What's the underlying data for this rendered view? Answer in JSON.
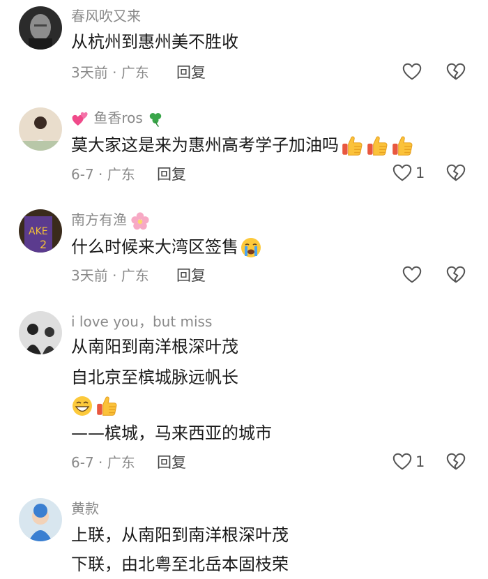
{
  "comments": [
    {
      "username": "春风吹又来",
      "lines": [
        "从杭州到惠州美不胜收"
      ],
      "meta": "3天前 · 广东",
      "reply": "回复",
      "like_count": ""
    },
    {
      "username": "鱼香ros",
      "lines": [
        "莫大家这是来为惠州高考学子加油吗"
      ],
      "meta": "6-7 · 广东",
      "reply": "回复",
      "like_count": "1"
    },
    {
      "username": "南方有渔",
      "lines": [
        "什么时候来大湾区签售"
      ],
      "meta": "3天前 · 广东",
      "reply": "回复",
      "like_count": ""
    },
    {
      "username": "i love you，but miss",
      "lines": [
        "从南阳到南洋根深叶茂",
        "自北京至槟城脉远帆长",
        "——槟城，马来西亚的城市"
      ],
      "meta": "6-7 · 广东",
      "reply": "回复",
      "like_count": "1"
    },
    {
      "username": "黄款",
      "lines": [
        "上联，从南阳到南洋根深叶茂",
        "下联，由北粤至北岳本固枝荣"
      ],
      "meta": "",
      "reply": "",
      "like_count": ""
    }
  ],
  "icons": {
    "like": "heart-outline-icon",
    "dislike": "broken-heart-outline-icon",
    "thumbs": "thumbs-up-emoji",
    "crying": "crying-face-emoji",
    "grin": "grinning-face-emoji",
    "hearts": "two-hearts-emoji",
    "clover": "shamrock-emoji",
    "blossom": "cherry-blossom-emoji"
  },
  "colors": {
    "username": "#8a8a8a",
    "text": "#1a1a1a",
    "meta": "#8a8a8a",
    "icon": "#555555"
  }
}
